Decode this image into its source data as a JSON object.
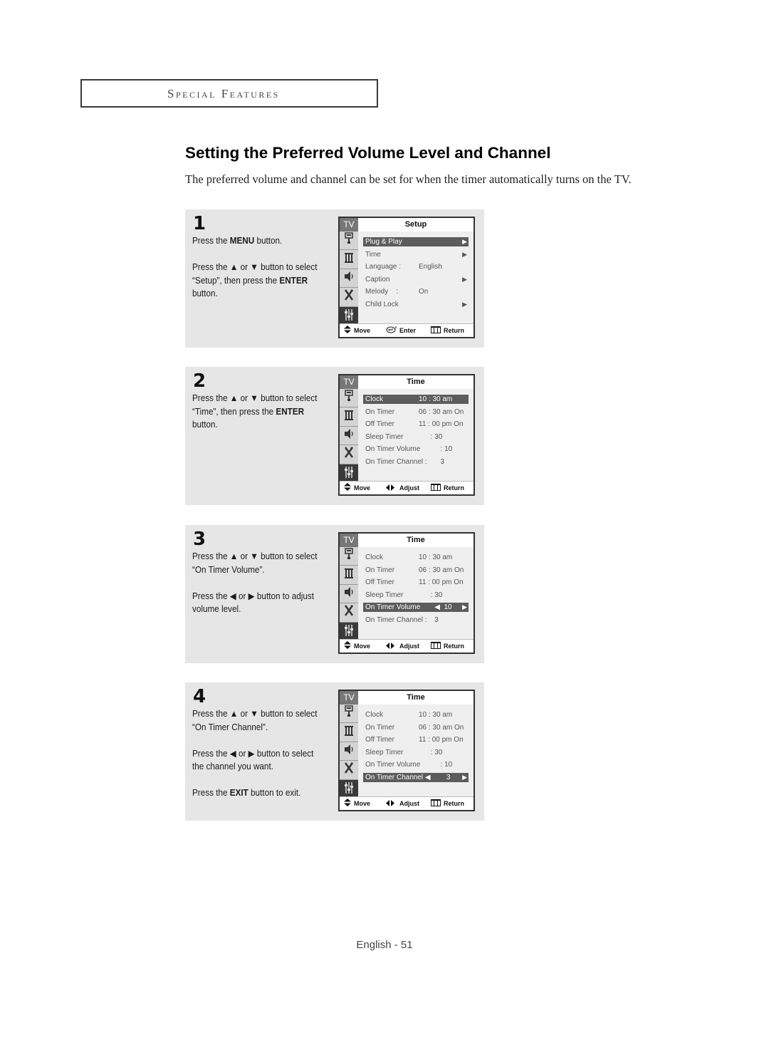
{
  "section_header": "Special Features",
  "title": "Setting the Preferred Volume Level and Channel",
  "intro": "The preferred volume and channel can be set for when the timer automatically turns on the TV.",
  "page_footer": "English - 51",
  "steps": [
    {
      "number": "1",
      "paragraphs": [
        [
          {
            "t": "Press the "
          },
          {
            "t": "MENU",
            "b": true
          },
          {
            "t": " button."
          }
        ],
        [
          {
            "t": "Press the ▲ or ▼ button to select “Setup”, then press the "
          },
          {
            "t": "ENTER",
            "b": true
          },
          {
            "t": " button."
          }
        ]
      ],
      "osd": {
        "tv_label": "TV",
        "title": "Setup",
        "rows": [
          {
            "label": "Plug & Play",
            "value": "",
            "arrow": "▶",
            "highlight": true
          },
          {
            "label": "Time",
            "value": "",
            "arrow": "▶"
          },
          {
            "label": "Language :",
            "value": "English",
            "arrow": ""
          },
          {
            "label": "Caption",
            "value": "",
            "arrow": "▶"
          },
          {
            "label": "Melody    :",
            "value": "On",
            "arrow": ""
          },
          {
            "label": "Child Lock",
            "value": "",
            "arrow": "▶"
          }
        ],
        "footer": {
          "move": "Move",
          "middle_icon": "enter-icon",
          "middle": "Enter",
          "return": "Return"
        }
      }
    },
    {
      "number": "2",
      "paragraphs": [
        [
          {
            "t": "Press the ▲ or ▼ button to select “Time”, then press the "
          },
          {
            "t": "ENTER",
            "b": true
          },
          {
            "t": " button."
          }
        ]
      ],
      "osd": {
        "tv_label": "TV",
        "title": "Time",
        "rows": [
          {
            "label": "Clock",
            "value": "10 : 30 am",
            "arrow": "",
            "highlight": true
          },
          {
            "label": "On Timer",
            "value": "06 : 30 am On",
            "arrow": ""
          },
          {
            "label": "Off Timer",
            "value": "11 : 00 pm On",
            "arrow": ""
          },
          {
            "label": "Sleep Timer",
            "value": "      : 30",
            "arrow": ""
          },
          {
            "label": "On Timer Volume",
            "value": "           : 10",
            "arrow": ""
          },
          {
            "label": "On Timer Channel :",
            "value": "           3",
            "arrow": ""
          }
        ],
        "footer": {
          "move": "Move",
          "middle_icon": "left-right-icon",
          "middle": "Adjust",
          "return": "Return"
        }
      }
    },
    {
      "number": "3",
      "paragraphs": [
        [
          {
            "t": "Press the ▲ or ▼ button to select “On Timer Volume”."
          }
        ],
        [
          {
            "t": "Press the ◀ or ▶ button to adjust volume level."
          }
        ]
      ],
      "osd": {
        "tv_label": "TV",
        "title": "Time",
        "rows": [
          {
            "label": "Clock",
            "value": "10 : 30 am",
            "arrow": ""
          },
          {
            "label": "On Timer",
            "value": "06 : 30 am On",
            "arrow": ""
          },
          {
            "label": "Off Timer",
            "value": "11 : 00 pm On",
            "arrow": ""
          },
          {
            "label": "Sleep Timer",
            "value": "      : 30",
            "arrow": ""
          },
          {
            "label": "On Timer Volume",
            "value": "        ◀  10",
            "arrow": "▶",
            "highlight": true
          },
          {
            "label": "On Timer Channel :",
            "value": "        3",
            "arrow": ""
          }
        ],
        "footer": {
          "move": "Move",
          "middle_icon": "left-right-icon",
          "middle": "Adjust",
          "return": "Return"
        }
      }
    },
    {
      "number": "4",
      "paragraphs": [
        [
          {
            "t": "Press the ▲ or ▼ button to select “On Timer Channel”."
          }
        ],
        [
          {
            "t": "Press the ◀ or ▶ button to select the channel you want."
          }
        ],
        [
          {
            "t": "Press the "
          },
          {
            "t": "EXIT",
            "b": true
          },
          {
            "t": " button to exit."
          }
        ]
      ],
      "osd": {
        "tv_label": "TV",
        "title": "Time",
        "rows": [
          {
            "label": "Clock",
            "value": "10 : 30 am",
            "arrow": ""
          },
          {
            "label": "On Timer",
            "value": "06 : 30 am On",
            "arrow": ""
          },
          {
            "label": "Off Timer",
            "value": "11 : 00 pm On",
            "arrow": ""
          },
          {
            "label": "Sleep Timer",
            "value": "      : 30",
            "arrow": ""
          },
          {
            "label": "On Timer Volume",
            "value": "           : 10",
            "arrow": ""
          },
          {
            "label": "On Timer Channel ◀",
            "value": "              3",
            "arrow": "▶",
            "highlight": true
          }
        ],
        "footer": {
          "move": "Move",
          "middle_icon": "left-right-icon",
          "middle": "Adjust",
          "return": "Return"
        }
      }
    }
  ],
  "osd_side_icons": [
    "input-icon",
    "picture-icon",
    "sound-icon",
    "channel-antenna-icon",
    "setup-sliders-icon"
  ],
  "colors": {
    "panel_bg": "#e6e6e6",
    "highlight_bar": "#5c5c5c",
    "osd_active_tab": "#3a3a3a"
  }
}
